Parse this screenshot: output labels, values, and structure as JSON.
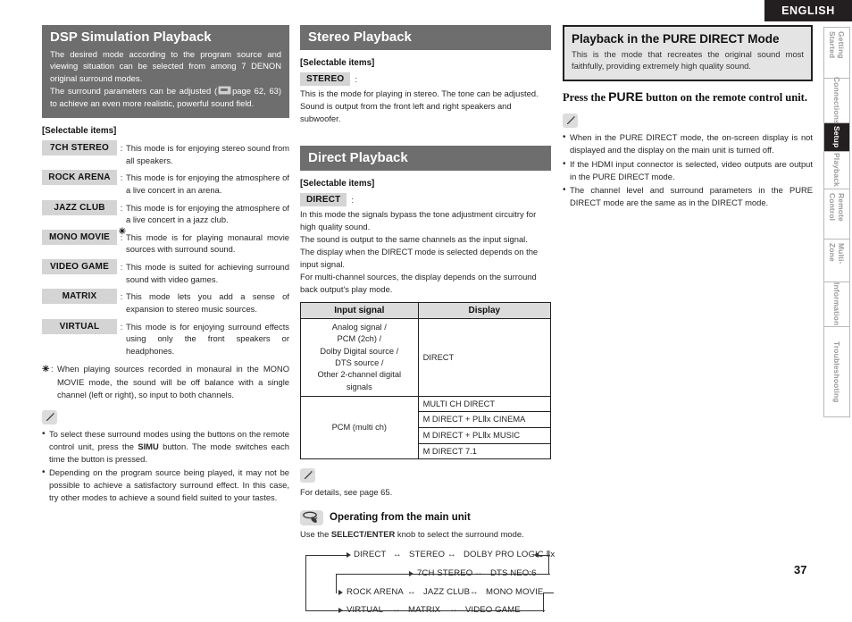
{
  "header": {
    "language_badge": "ENGLISH"
  },
  "page_number": "37",
  "sidebar": {
    "tabs": [
      {
        "label": "Getting Started",
        "active": false
      },
      {
        "label": "Connections",
        "active": false
      },
      {
        "label": "Setup",
        "active": true
      },
      {
        "label": "Playback",
        "active": false
      },
      {
        "label": "Remote Control",
        "active": false
      },
      {
        "label": "Multi-Zone",
        "active": false
      },
      {
        "label": "Information",
        "active": false
      },
      {
        "label": "Troubleshooting",
        "active": false
      }
    ]
  },
  "col1": {
    "section": {
      "title": "DSP Simulation Playback",
      "body_part1": "The desired mode according to the program source and viewing situation can be selected from among 7 DENON original surround modes.",
      "body_part2a": "The surround parameters can be adjusted (",
      "body_part2b": "page 62, 63) to achieve an even more realistic, powerful sound field."
    },
    "selectable_heading": "[Selectable items]",
    "items": [
      {
        "chip": "7CH STEREO",
        "star": false,
        "desc": "This mode is for enjoying stereo sound from all speakers."
      },
      {
        "chip": "ROCK ARENA",
        "star": false,
        "desc": "This mode is for enjoying the atmosphere of a live concert in an arena."
      },
      {
        "chip": "JAZZ CLUB",
        "star": false,
        "desc": "This mode is for enjoying the atmosphere of a live concert in a jazz club."
      },
      {
        "chip": "MONO MOVIE",
        "star": true,
        "desc": "This mode is for playing monaural movie sources with surround sound."
      },
      {
        "chip": "VIDEO GAME",
        "star": false,
        "desc": "This mode is suited for achieving surround sound with video games."
      },
      {
        "chip": "MATRIX",
        "star": false,
        "desc": "This mode lets you add a sense of expansion to stereo music sources."
      },
      {
        "chip": "VIRTUAL",
        "star": false,
        "desc": "This mode is for enjoying surround effects using only the front speakers or headphones."
      }
    ],
    "footnote": {
      "marker": "✳",
      "colon": ":",
      "text": "When playing sources recorded in monaural in the MONO MOVIE mode, the sound will be off balance with a single channel (left or right), so input to both channels."
    },
    "notes": [
      "To select these surround modes using the buttons on the remote control unit, press the SIMU button. The mode switches each time the button is pressed.",
      "Depending on the program source being played, it may not be possible to achieve a satisfactory surround effect. In this case, try other modes to achieve a sound field suited to your tastes."
    ],
    "note_bold_terms": [
      "SIMU"
    ]
  },
  "col2": {
    "stereo": {
      "title": "Stereo Playback",
      "selectable_heading": "[Selectable items]",
      "chip": "STEREO",
      "colon": ":",
      "line1": "This is the mode for playing in stereo. The tone can be adjusted.",
      "line2": "Sound is output from the front left and right speakers and subwoofer."
    },
    "direct": {
      "title": "Direct Playback",
      "selectable_heading": "[Selectable items]",
      "chip": "DIRECT",
      "colon": ":",
      "line1": "In this mode the signals bypass the tone adjustment circuitry for high quality sound.",
      "line2": "The sound is output to the same channels as the input signal.",
      "line3": "The display when the DIRECT mode is selected depends on the input signal.",
      "line4": "For multi-channel sources, the display depends on the surround back output's play mode."
    },
    "table": {
      "headers": [
        "Input signal",
        "Display"
      ],
      "rows": [
        {
          "input": "Analog signal /\nPCM (2ch) /\nDolby Digital source /\nDTS source /\nOther 2-channel digital signals",
          "displays": [
            "DIRECT"
          ]
        },
        {
          "input": "PCM (multi ch)",
          "displays": [
            "MULTI CH DIRECT",
            "M DIRECT + PLⅡx CINEMA",
            "M DIRECT + PLⅡx MUSIC",
            "M DIRECT 7.1"
          ]
        }
      ]
    },
    "detail_note": "For details, see page 65.",
    "main_unit": {
      "title": "Operating from the main unit",
      "subtitle_pre": "Use the ",
      "subtitle_bold": "SELECT/ENTER",
      "subtitle_post": " knob to select the surround mode."
    },
    "flow": {
      "row1": [
        "DIRECT",
        "STEREO",
        "DOLBY PRO LOGIC Ⅱx"
      ],
      "row2": [
        "7CH STEREO",
        "DTS NEO:6"
      ],
      "row3": [
        "ROCK ARENA",
        "JAZZ CLUB",
        "MONO MOVIE"
      ],
      "row4": [
        "VIRTUAL",
        "MATRIX",
        "VIDEO GAME"
      ]
    }
  },
  "col3": {
    "framed": {
      "title": "Playback in the PURE DIRECT Mode",
      "body": "This is the mode that recreates the original sound most faithfully, providing extremely high quality sound."
    },
    "press_pre": "Press the ",
    "press_bold": "PURE",
    "press_post": " button on the remote control unit.",
    "notes": [
      "When in the PURE DIRECT mode, the on-screen display is not displayed and the display on the main unit is turned off.",
      "If the HDMI input connector is selected, video outputs are output in the PURE DIRECT mode.",
      "The channel level and surround parameters in the PURE DIRECT mode are the same as in the DIRECT mode."
    ]
  },
  "colors": {
    "bar_gray": "#6e6e6e",
    "chip_gray": "#d4d4d4",
    "banner_black": "#231f20",
    "frame_bg": "#e4e4e4"
  }
}
